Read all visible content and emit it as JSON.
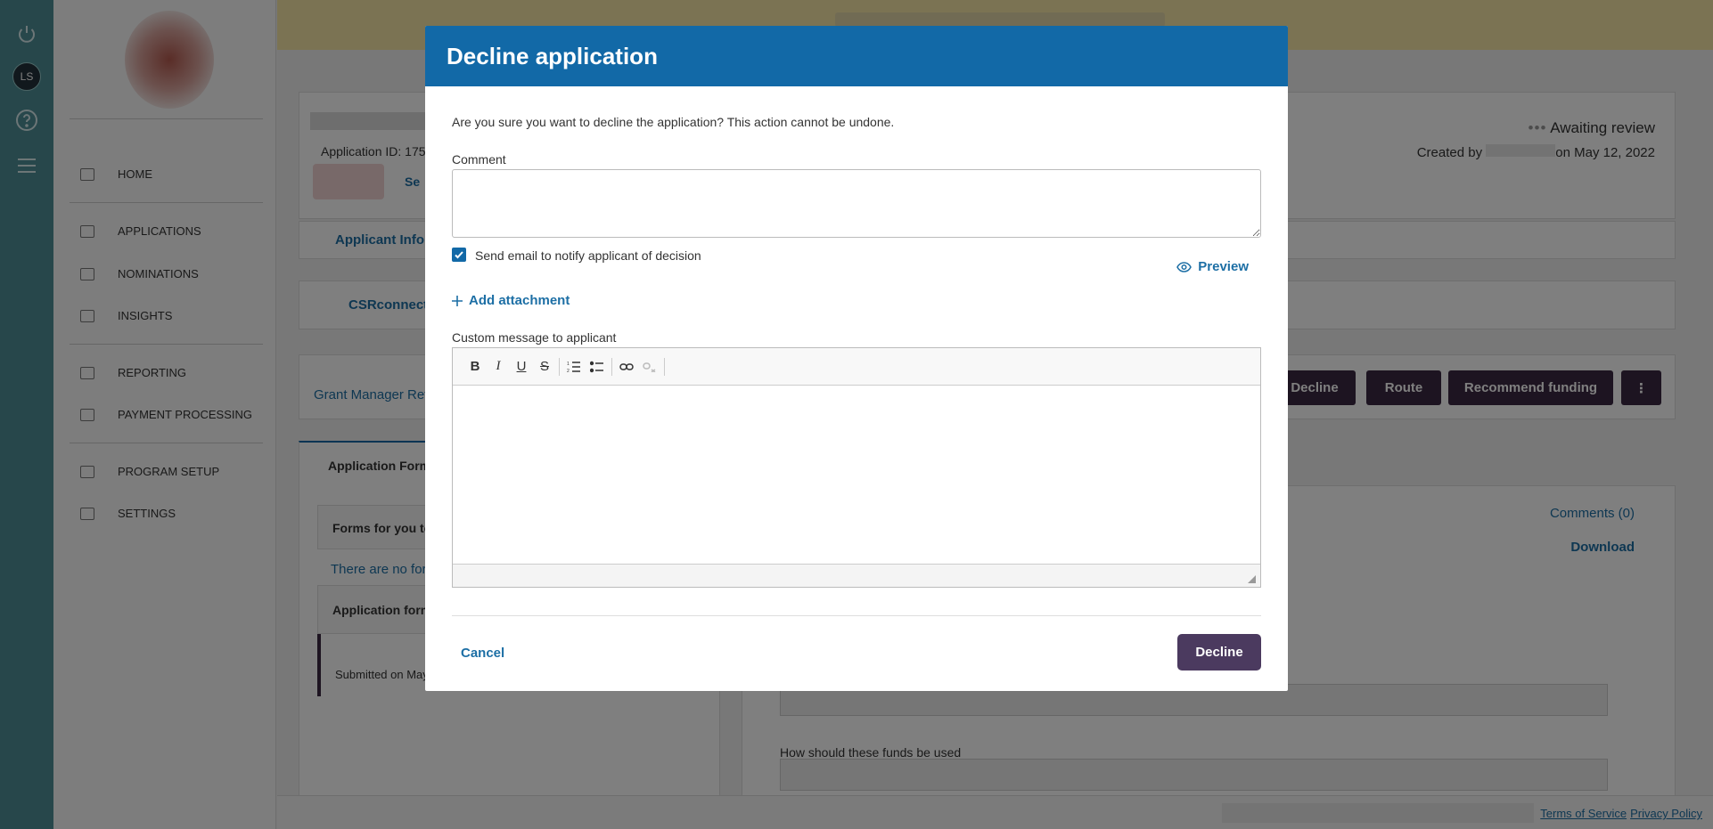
{
  "rail": {
    "avatar_initials": "LS"
  },
  "sidebar": {
    "items": [
      {
        "label": "HOME",
        "icon": "home-icon"
      },
      {
        "label": "APPLICATIONS",
        "icon": "clipboard-icon"
      },
      {
        "label": "NOMINATIONS",
        "icon": "award-icon"
      },
      {
        "label": "INSIGHTS",
        "icon": "chart-icon"
      },
      {
        "label": "REPORTING",
        "icon": "report-icon"
      },
      {
        "label": "PAYMENT PROCESSING",
        "icon": "money-icon"
      },
      {
        "label": "PROGRAM SETUP",
        "icon": "toolbox-icon"
      },
      {
        "label": "SETTINGS",
        "icon": "gear-icon"
      }
    ]
  },
  "background": {
    "application_id_label": "Application ID: 175",
    "tag_text": "Se",
    "status": "Awaiting review",
    "created_by_prefix": "Created by",
    "created_on": "on May 12, 2022",
    "applicant_info": "Applicant Info",
    "csrconnect": "CSRconnect I",
    "grant_manager_review": "Grant Manager Revi",
    "buttons": {
      "decline": "Decline",
      "route": "Route",
      "recommend": "Recommend funding",
      "more": "⋮"
    },
    "tab_application_form": "Application Form",
    "forms_for_you": "Forms for you to",
    "no_forms": "There are no for",
    "application_forms": "Application form",
    "submitted_on": "Submitted on May",
    "comments_link": "Comments (0)",
    "download_link": "Download",
    "funds_question": "How should these funds be used"
  },
  "footer": {
    "terms": "Terms of Service",
    "privacy": "Privacy Policy"
  },
  "modal": {
    "title": "Decline application",
    "confirm_text": "Are you sure you want to decline the application? This action cannot be undone.",
    "comment_label": "Comment",
    "comment_value": "",
    "send_email_label": "Send email to notify applicant of decision",
    "send_email_checked": true,
    "preview_label": "Preview",
    "add_attachment_label": "Add attachment",
    "custom_message_label": "Custom message to applicant",
    "toolbar": [
      "bold",
      "italic",
      "underline",
      "strikethrough",
      "ordered-list",
      "bullet-list",
      "link",
      "unlink"
    ],
    "cancel_label": "Cancel",
    "decline_label": "Decline"
  }
}
